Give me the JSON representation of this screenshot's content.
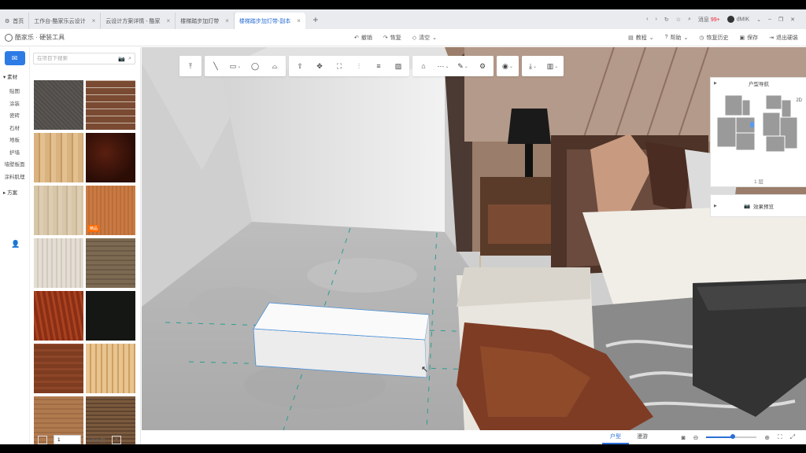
{
  "tabs": [
    {
      "label": "首页",
      "active": false
    },
    {
      "label": "工作台-酷家乐云设计",
      "active": false
    },
    {
      "label": "云设计方案详情 - 酷家",
      "active": false
    },
    {
      "label": "楼梯踏步加灯带",
      "active": false
    },
    {
      "label": "楼梯踏步加灯带-副本",
      "active": true
    }
  ],
  "browser_right": {
    "msg_label": "消息",
    "msg_badge": "99+",
    "user": "dMIK"
  },
  "app": {
    "logo_text": "酷家乐 · 硬装工具",
    "center_actions": [
      "撤销",
      "恢复",
      "清空"
    ],
    "right_actions": [
      "教程",
      "帮助",
      "恢复历史",
      "保存",
      "退出硬装"
    ]
  },
  "rail": {
    "top_icon": "mail-icon",
    "group1": "素材",
    "items": [
      "贴图",
      "涂装",
      "瓷砖",
      "石材",
      "地板",
      "护墙",
      "墙壁板面",
      "涂料肌理"
    ],
    "group2": "方案"
  },
  "panel": {
    "search_placeholder": "在项目下搜索",
    "tiles": [
      {
        "name": "dark-gray-fabric",
        "tag": ""
      },
      {
        "name": "brick-wall",
        "tag": ""
      },
      {
        "name": "light-oak",
        "tag": ""
      },
      {
        "name": "dark-burl",
        "tag": ""
      },
      {
        "name": "beige-wood",
        "tag": ""
      },
      {
        "name": "teak-wood",
        "tag": "精品"
      },
      {
        "name": "white-oak",
        "tag": ""
      },
      {
        "name": "smoked-oak",
        "tag": ""
      },
      {
        "name": "mahogany",
        "tag": ""
      },
      {
        "name": "black-marble",
        "tag": ""
      },
      {
        "name": "walnut",
        "tag": ""
      },
      {
        "name": "maple-grain",
        "tag": ""
      },
      {
        "name": "ash-wood",
        "tag": ""
      },
      {
        "name": "rough-wood",
        "tag": ""
      }
    ],
    "page_current": "1",
    "page_total": "/ 250 页"
  },
  "minimap": {
    "title": "户型导航",
    "view_label": "2D",
    "floor_label": "1 层"
  },
  "preview": {
    "label": "效果预览"
  },
  "bottom": {
    "tabs": [
      "户型",
      "漫游"
    ],
    "active_tab": 0,
    "zoom_fraction": 0.52
  },
  "colors": {
    "accent": "#2c6fd6",
    "rail_button": "#2d7be5",
    "tag_orange": "#ff6a00"
  }
}
